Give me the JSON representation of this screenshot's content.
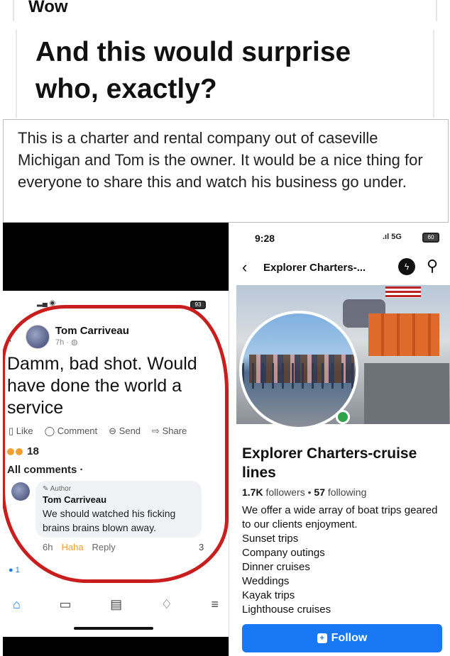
{
  "header": {
    "small_title": "Wow",
    "headline": "And this would surprise who, exactly?"
  },
  "post_text": "This is a charter and rental company out of caseville Michigan and Tom is the owner. It would be a nice thing for everyone to share this and watch his business go under.",
  "left_screenshot": {
    "battery": "93",
    "poster": {
      "name": "Tom Carriveau",
      "time": "7h · "
    },
    "body": "Damm, bad shot. Would have done the world a service",
    "actions": [
      "Like",
      "Comment",
      "Send",
      "Share"
    ],
    "reaction_count": "18",
    "all_comments": "All comments ·",
    "comment": {
      "author_tag": "Author",
      "name": "Tom Carriveau",
      "text": "We should watched his ficking brains brains blown away.",
      "time": "6h",
      "haha": "Haha",
      "reply": "Reply",
      "count": "3"
    },
    "reply_count": "1",
    "tabs": [
      "home-icon",
      "video-icon",
      "marketplace-icon",
      "bell-icon",
      "menu-icon"
    ]
  },
  "right_screenshot": {
    "time": "9:28",
    "signal": "5G",
    "battery": "60",
    "nav_title": "Explorer Charters-...",
    "page_name": "Explorer Charters-cruise lines",
    "followers": "1.7K",
    "followers_label": "followers",
    "following": "57",
    "following_label": "following",
    "bio_intro": "We offer a wide array of boat trips geared to our clients enjoyment.",
    "bio_items": [
      "Sunset trips",
      "Company outings",
      "Dinner cruises",
      "Weddings",
      "Kayak trips",
      "Lighthouse cruises"
    ],
    "follow_label": "Follow"
  },
  "colors": {
    "accent": "#1877f2",
    "annotation": "#c81e1e"
  }
}
